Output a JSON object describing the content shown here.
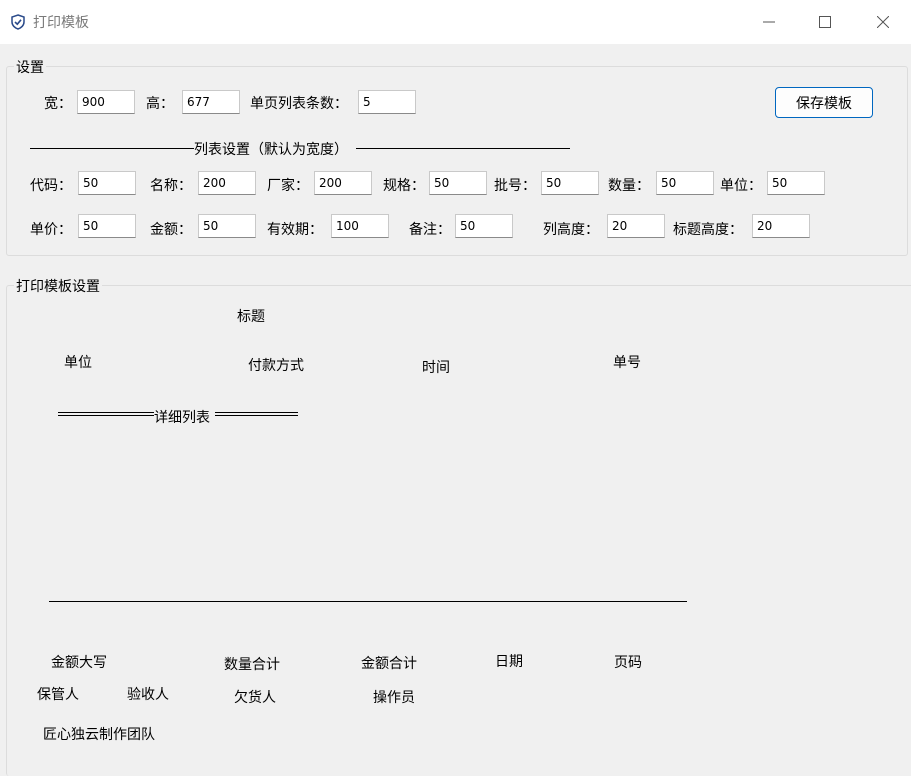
{
  "window": {
    "title": "打印模板",
    "icon": "shield-check-icon",
    "controls": [
      "minimize-icon",
      "maximize-icon",
      "close-icon"
    ]
  },
  "settings": {
    "group_label": "设置",
    "width_label": "宽：",
    "width_value": "900",
    "height_label": "高：",
    "height_value": "677",
    "rows_label": "单页列表条数：",
    "rows_value": "5",
    "save_button": "保存模板",
    "columns_header": "列表设置（默认为宽度）",
    "row1": [
      {
        "label": "代码：",
        "value": "50"
      },
      {
        "label": "名称：",
        "value": "200"
      },
      {
        "label": "厂家：",
        "value": "200"
      },
      {
        "label": "规格：",
        "value": "50"
      },
      {
        "label": "批号：",
        "value": "50"
      },
      {
        "label": "数量：",
        "value": "50"
      },
      {
        "label": "单位：",
        "value": "50"
      }
    ],
    "row2": [
      {
        "label": "单价：",
        "value": "50"
      },
      {
        "label": "金额：",
        "value": "50"
      },
      {
        "label": "有效期：",
        "value": "100"
      },
      {
        "label": "备注：",
        "value": "50"
      },
      {
        "label": "列高度：",
        "value": "20"
      },
      {
        "label": "标题高度：",
        "value": "20"
      }
    ]
  },
  "template": {
    "group_label": "打印模板设置",
    "title": "标题",
    "unit": "单位",
    "payment": "付款方式",
    "time": "时间",
    "doc_no": "单号",
    "detail_list": "详细列表",
    "amount_words": "金额大写",
    "qty_total": "数量合计",
    "amount_total": "金额合计",
    "date": "日期",
    "page_no": "页码",
    "keeper": "保管人",
    "checker": "验收人",
    "debtor": "欠货人",
    "operator": "操作员",
    "footer": "匠心独云制作团队"
  }
}
